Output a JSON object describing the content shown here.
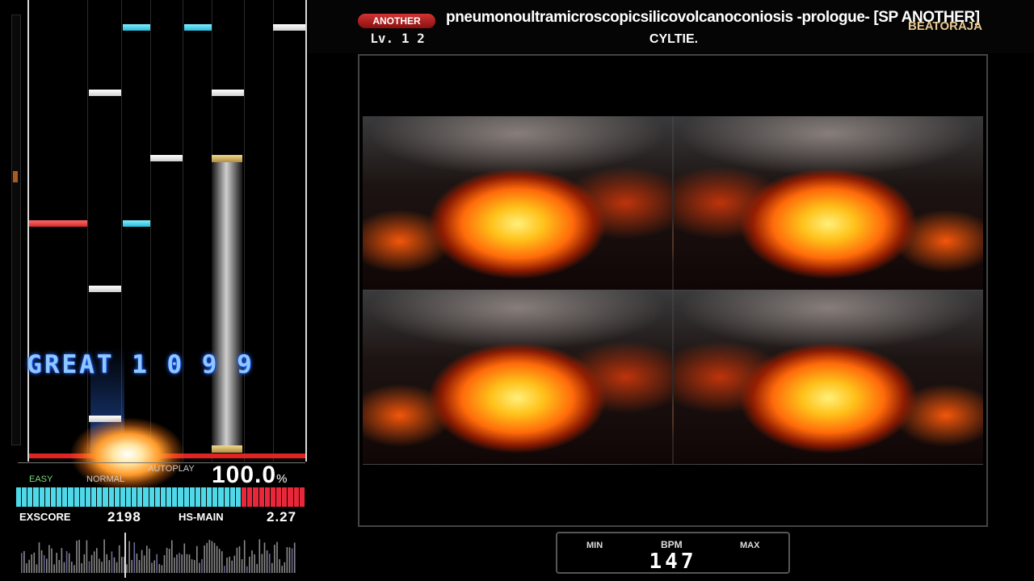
{
  "header": {
    "difficulty_badge": "ANOTHER",
    "level": "Lv. 1 2",
    "title": "pneumonoultramicroscopicsilicovolcanoconiosis -prologue- [SP ANOTHER]",
    "artist": "CYLTIE.",
    "brand": "BEATORAJA"
  },
  "judge": {
    "text": "GREAT 1 0 9 9"
  },
  "gauge": {
    "easy_label": "EASY",
    "normal_label": "NORMAL",
    "autoplay_label": "AUTOPLAY",
    "percent": "100.0",
    "percent_unit": "%",
    "segments_total": 50,
    "segments_red_from": 39,
    "colors": {
      "blue": "#4fd8e8",
      "red": "#e8283a"
    }
  },
  "stats": {
    "exscore_label": "EXSCORE",
    "exscore_value": "2198",
    "hs_label": "HS-MAIN",
    "hs_value": "2.27"
  },
  "bpm": {
    "min_label": "MIN",
    "title": "BPM",
    "max_label": "MAX",
    "value": "147"
  }
}
